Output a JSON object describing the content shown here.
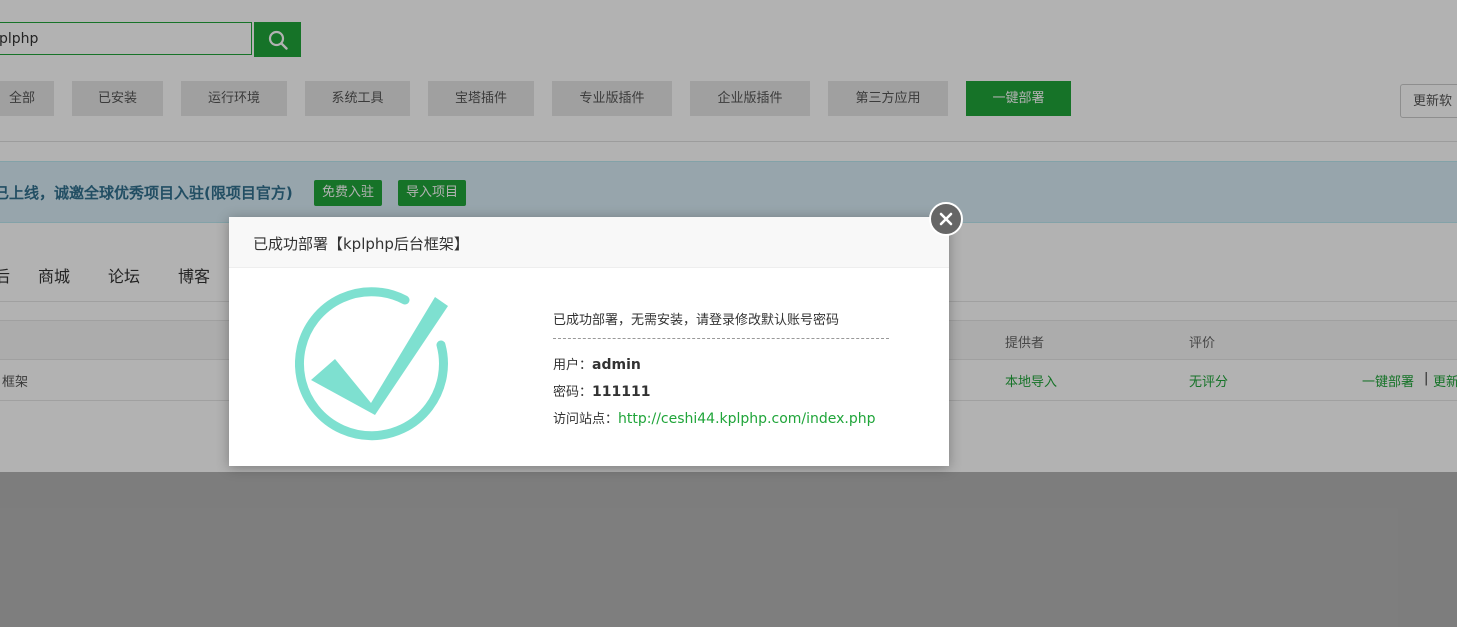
{
  "search": {
    "value": "plphp"
  },
  "categories": [
    "全部",
    "已安装",
    "运行环境",
    "系统工具",
    "宝塔插件",
    "专业版插件",
    "企业版插件",
    "第三方应用",
    "一键部署"
  ],
  "active_category": "一键部署",
  "update_button": "更新软",
  "banner": {
    "text": "已上线，诚邀全球优秀项目入驻(限项目官方)",
    "buttons": [
      "免费入驻",
      "导入项目"
    ]
  },
  "subtabs": [
    "后",
    "商城",
    "论坛",
    "博客"
  ],
  "table": {
    "headers": {
      "provider": "提供者",
      "rating": "评价"
    },
    "row": {
      "name": "框架",
      "provider": "本地导入",
      "rating": "无评分",
      "action_deploy": "一键部署",
      "separator": "|",
      "action_update": "更新"
    }
  },
  "modal": {
    "title": "已成功部署【kplphp后台框架】",
    "message": "已成功部署，无需安装，请登录修改默认账号密码",
    "user_label": "用户：",
    "user_value": "admin",
    "password_label": "密码：",
    "password_value": "111111",
    "site_label": "访问站点：",
    "site_url": "http://ceshi44.kplphp.com/index.php"
  },
  "colors": {
    "accent": "#20a53a",
    "check": "#7ee0d0",
    "banner_bg": "#d9edf7"
  },
  "icons": {
    "search": "search-icon",
    "close": "close-icon",
    "success": "check-circle-icon"
  }
}
